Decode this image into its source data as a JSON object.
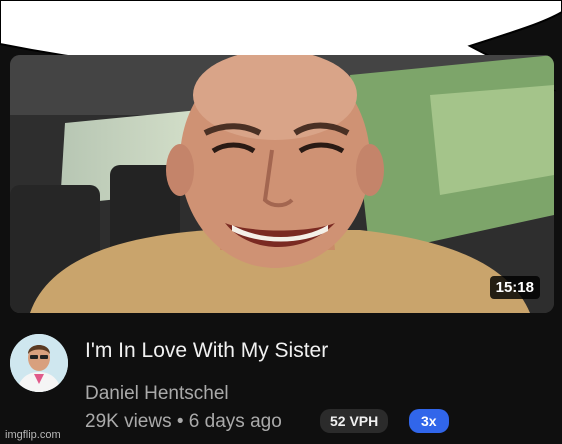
{
  "video": {
    "duration": "15:18",
    "title": "I'm In Love With My Sister",
    "channel": "Daniel Hentschel",
    "meta": "29K views • 6 days ago",
    "badges": {
      "vph": "52 VPH",
      "multiplier": "3x"
    }
  },
  "watermark": "imgflip.com",
  "colors": {
    "background": "#0f0f0f",
    "multiplier_badge": "#3166ea",
    "vph_badge": "#2b2b2b"
  }
}
